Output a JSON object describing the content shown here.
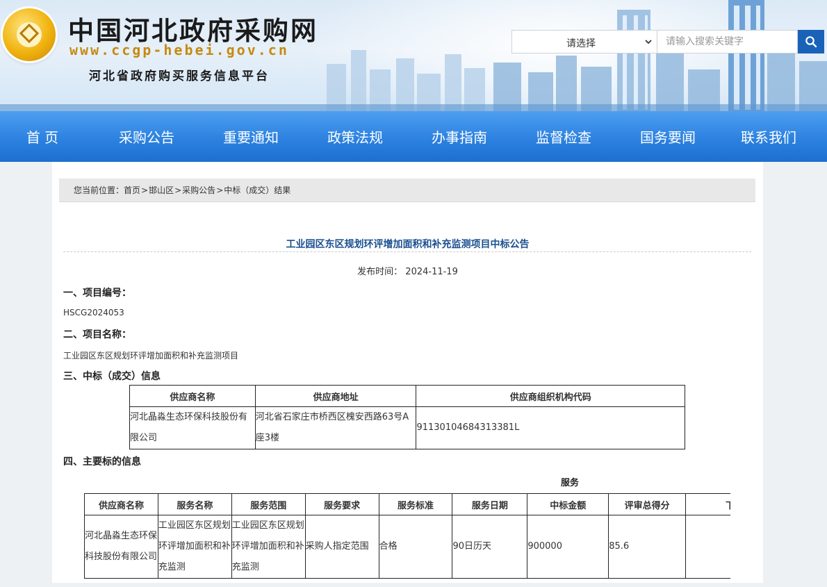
{
  "header": {
    "site_title": "中国河北政府采购网",
    "site_url": "www.ccgp-hebei.gov.cn",
    "site_subtitle": "河北省政府购买服务信息平台",
    "search": {
      "select_value": "请选择",
      "placeholder": "请输入搜索关键字",
      "button_icon": "search-icon"
    }
  },
  "nav": {
    "items": [
      {
        "label": "首 页"
      },
      {
        "label": "采购公告"
      },
      {
        "label": "重要通知"
      },
      {
        "label": "政策法规"
      },
      {
        "label": "办事指南"
      },
      {
        "label": "监督检查"
      },
      {
        "label": "国务要闻"
      },
      {
        "label": "联系我们"
      }
    ]
  },
  "breadcrumb": {
    "prefix": "您当前位置：",
    "items": [
      "首页",
      "邯山区",
      "采购公告",
      "中标（成交）结果"
    ],
    "separator": ">"
  },
  "notice": {
    "title": "工业园区东区规划环评增加面积和补充监测项目中标公告",
    "pubdate_label": "发布时间：",
    "pubdate": "2024-11-19",
    "sec1_heading": "一、项目编号：",
    "project_code": "HSCG2024053",
    "sec2_heading": "二、项目名称：",
    "project_name": "工业园区东区规划环评增加面积和补充监测项目",
    "sec3_heading": "三、中标（成交）信息",
    "supplier_table": {
      "headers": [
        "供应商名称",
        "供应商地址",
        "供应商组织机构代码"
      ],
      "row": [
        "河北晶淼生态环保科技股份有限公司",
        "河北省石家庄市桥西区槐安西路63号A座3楼",
        "91130104684313381L"
      ]
    },
    "sec4_heading": "四、主要标的信息",
    "service_heading": "服务",
    "service_table": {
      "headers": [
        "供应商名称",
        "服务名称",
        "服务范围",
        "服务要求",
        "服务标准",
        "服务日期",
        "中标金额",
        "评审总得分",
        "下浮率"
      ],
      "row": [
        "河北晶淼生态环保科技股份有限公司",
        "工业园区东区规划环评增加面积和补充监测",
        "工业园区东区规划环评增加面积和补充监测",
        "采购人指定范围",
        "合格",
        "90日历天",
        "900000",
        "85.6",
        ""
      ]
    }
  },
  "colors": {
    "nav_blue": "#2d82e0",
    "title_blue": "#1a4f8f",
    "logo_gold": "#f0b30e",
    "search_button": "#1a62b8"
  }
}
